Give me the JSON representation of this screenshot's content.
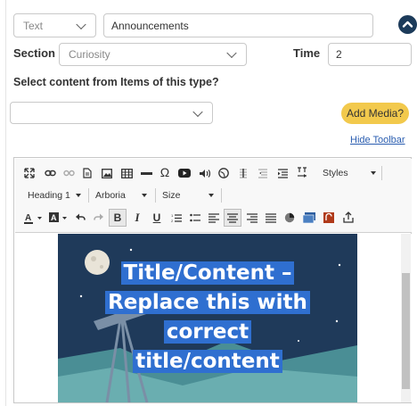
{
  "form": {
    "type_select": "Text",
    "title_input": "Announcements",
    "section_label": "Section",
    "section_select": "Curiosity",
    "time_label": "Time",
    "time_input": "2",
    "content_heading": "Select content from Items of this type?",
    "items_select": "",
    "add_media_label": "Add Media?",
    "hide_toolbar_label": "Hide Toolbar"
  },
  "toolbar": {
    "styles_combo": "Styles",
    "format_combo": "Heading 1",
    "font_combo": "Arboria",
    "size_combo": "Size",
    "bold": "B",
    "italic": "I",
    "underline": "U",
    "omega": "Ω"
  },
  "editor": {
    "hero_title_lines": [
      "Title/Content –",
      "Replace this with",
      "correct",
      "title/content"
    ]
  },
  "colors": {
    "accent": "#1c3b5a",
    "add_media_bg": "#f2c94c",
    "link": "#2a5db0",
    "hero_bg": "#1f3a5a",
    "selection": "#2f6fd0"
  },
  "icons": {
    "collapse": "chevron-up-circle-icon"
  }
}
